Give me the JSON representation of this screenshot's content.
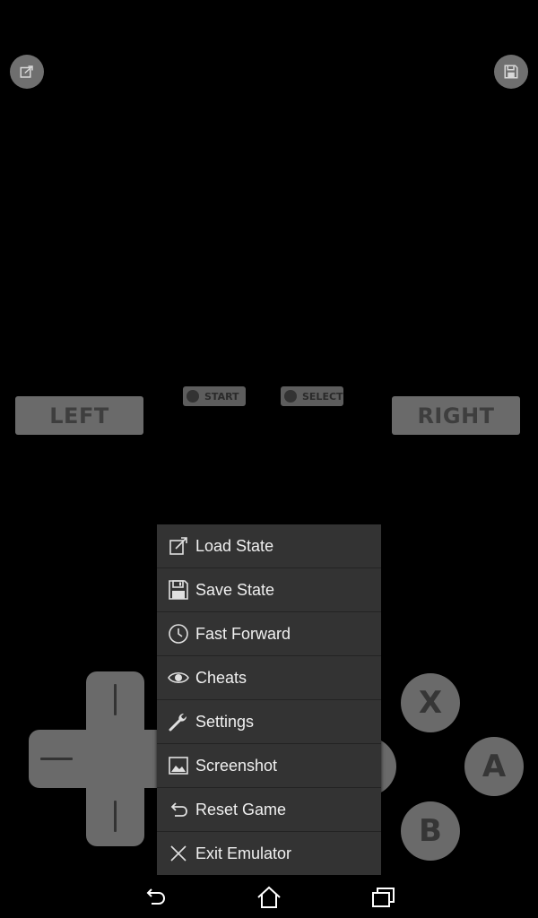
{
  "controls": {
    "left_label": "LEFT",
    "right_label": "RIGHT",
    "start_label": "START",
    "select_label": "SELECT",
    "x_label": "X",
    "a_label": "A",
    "b_label": "B"
  },
  "menu": {
    "items": [
      {
        "label": "Load State",
        "icon": "load-state-icon"
      },
      {
        "label": "Save State",
        "icon": "save-state-icon"
      },
      {
        "label": "Fast Forward",
        "icon": "clock-icon"
      },
      {
        "label": "Cheats",
        "icon": "eye-icon"
      },
      {
        "label": "Settings",
        "icon": "wrench-icon"
      },
      {
        "label": "Screenshot",
        "icon": "picture-icon"
      },
      {
        "label": "Reset Game",
        "icon": "undo-icon"
      },
      {
        "label": "Exit Emulator",
        "icon": "close-icon"
      }
    ]
  },
  "navbar": {
    "icons": [
      "back-icon",
      "home-icon",
      "recent-apps-icon"
    ]
  },
  "colors": {
    "background": "#000000",
    "control_gray": "#6a6a6a",
    "menu_background": "#333333",
    "menu_text": "#f0f0f0"
  }
}
